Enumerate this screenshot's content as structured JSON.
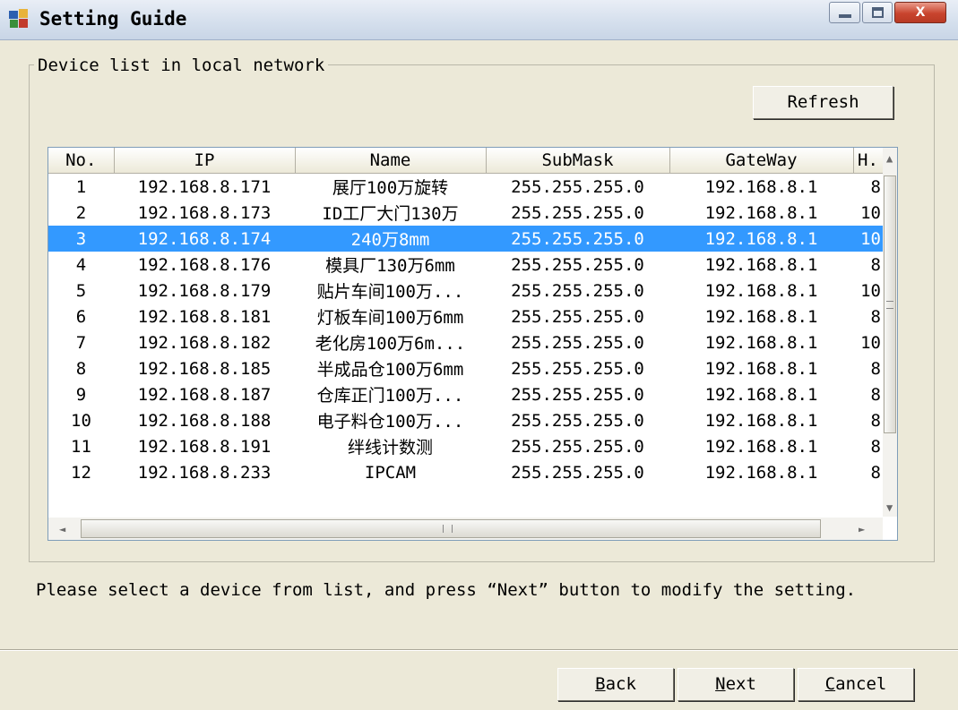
{
  "window": {
    "title": "Setting Guide",
    "close_glyph": "x"
  },
  "group": {
    "label": "Device list in local network",
    "refresh_label": "Refresh"
  },
  "table": {
    "columns": [
      "No.",
      "IP",
      "Name",
      "SubMask",
      "GateWay",
      "H."
    ],
    "rows": [
      [
        "1",
        "192.168.8.171",
        "展厅100万旋转",
        "255.255.255.0",
        "192.168.8.1",
        "8"
      ],
      [
        "2",
        "192.168.8.173",
        "ID工厂大门130万",
        "255.255.255.0",
        "192.168.8.1",
        "10"
      ],
      [
        "3",
        "192.168.8.174",
        "240万8mm",
        "255.255.255.0",
        "192.168.8.1",
        "10"
      ],
      [
        "4",
        "192.168.8.176",
        "模具厂130万6mm",
        "255.255.255.0",
        "192.168.8.1",
        "8"
      ],
      [
        "5",
        "192.168.8.179",
        "贴片车间100万...",
        "255.255.255.0",
        "192.168.8.1",
        "10"
      ],
      [
        "6",
        "192.168.8.181",
        "灯板车间100万6mm",
        "255.255.255.0",
        "192.168.8.1",
        "8"
      ],
      [
        "7",
        "192.168.8.182",
        "老化房100万6m...",
        "255.255.255.0",
        "192.168.8.1",
        "10"
      ],
      [
        "8",
        "192.168.8.185",
        "半成品仓100万6mm",
        "255.255.255.0",
        "192.168.8.1",
        "8"
      ],
      [
        "9",
        "192.168.8.187",
        "仓库正门100万...",
        "255.255.255.0",
        "192.168.8.1",
        "8"
      ],
      [
        "10",
        "192.168.8.188",
        "电子料仓100万...",
        "255.255.255.0",
        "192.168.8.1",
        "8"
      ],
      [
        "11",
        "192.168.8.191",
        "绊线计数测",
        "255.255.255.0",
        "192.168.8.1",
        "8"
      ],
      [
        "12",
        "192.168.8.233",
        "IPCAM",
        "255.255.255.0",
        "192.168.8.1",
        "8"
      ]
    ],
    "selected_row": 3
  },
  "instruction": "Please select a device from list, and press “Next” button to modify the setting.",
  "buttons": {
    "back": {
      "accel": "B",
      "rest": "ack"
    },
    "next": {
      "accel": "N",
      "rest": "ext"
    },
    "cancel": {
      "accel": "C",
      "rest": "ancel"
    }
  },
  "colors": {
    "selection": "#3399ff",
    "window_bg": "#ece9d8"
  }
}
